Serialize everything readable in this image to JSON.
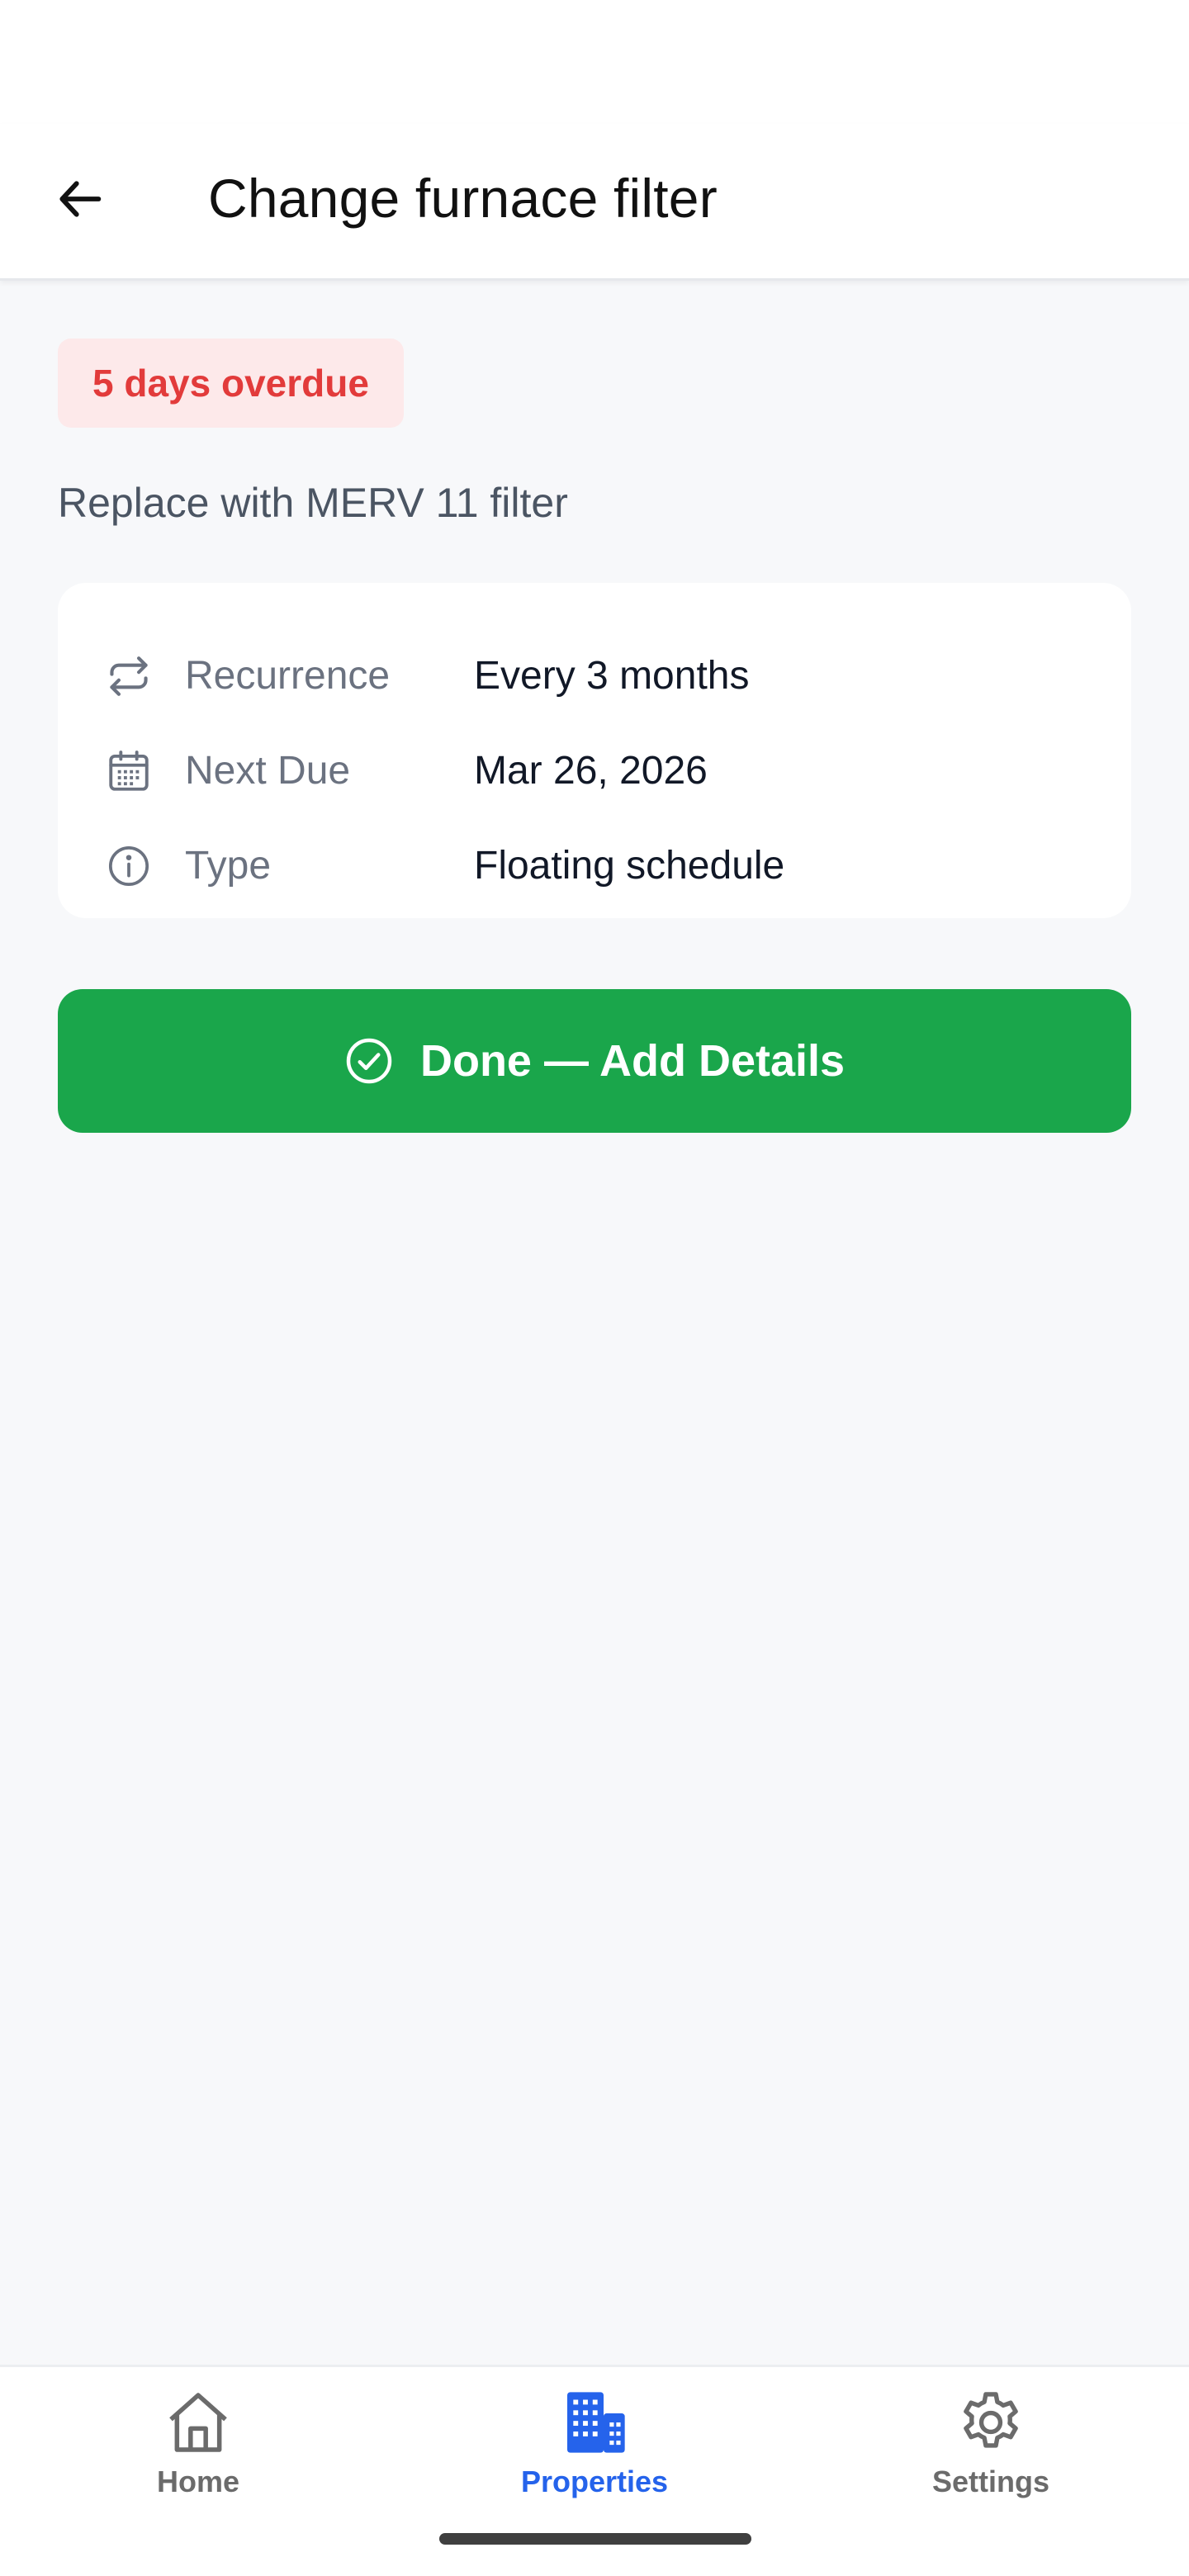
{
  "header": {
    "title": "Change furnace filter",
    "back_icon": "arrow-left-icon"
  },
  "task": {
    "status_badge": "5 days overdue",
    "status_color": "#e23b3b",
    "description": "Replace with MERV 11 filter"
  },
  "details": [
    {
      "icon": "repeat-icon",
      "label": "Recurrence",
      "value": "Every 3 months"
    },
    {
      "icon": "calendar-icon",
      "label": "Next Due",
      "value": "Mar 26, 2026"
    },
    {
      "icon": "info-icon",
      "label": "Type",
      "value": "Floating schedule"
    }
  ],
  "actions": {
    "done_label": "Done — Add Details",
    "done_icon": "check-circle-icon",
    "done_color": "#1aa64b"
  },
  "bottom_nav": {
    "active": "Properties",
    "accent_color": "#2563eb",
    "items": [
      {
        "label": "Home",
        "icon": "home-icon"
      },
      {
        "label": "Properties",
        "icon": "building-icon"
      },
      {
        "label": "Settings",
        "icon": "gear-icon"
      }
    ]
  }
}
